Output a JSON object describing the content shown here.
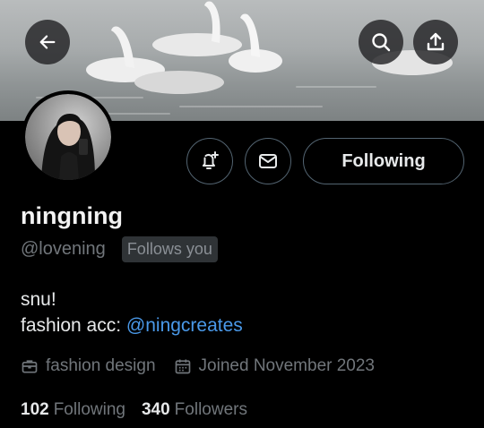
{
  "profile": {
    "display_name": "ningning",
    "handle": "@lovening",
    "follows_you_badge": "Follows you",
    "bio_line1": "snu!",
    "bio_line2_prefix": "fashion acc: ",
    "bio_line2_link": "@ningcreates",
    "category": "fashion design",
    "joined": "Joined November 2023",
    "following_count": "102",
    "following_label": "Following",
    "followers_count": "340",
    "followers_label": "Followers"
  },
  "actions": {
    "following_button": "Following"
  },
  "icons": {
    "back": "arrow-left-icon",
    "search": "search-icon",
    "share": "share-icon",
    "notify": "bell-plus-icon",
    "message": "envelope-icon",
    "category": "briefcase-icon",
    "joined": "calendar-icon"
  },
  "colors": {
    "background": "#000000",
    "link": "#4a99e9",
    "muted_text": "#71767b",
    "border": "#536471"
  }
}
